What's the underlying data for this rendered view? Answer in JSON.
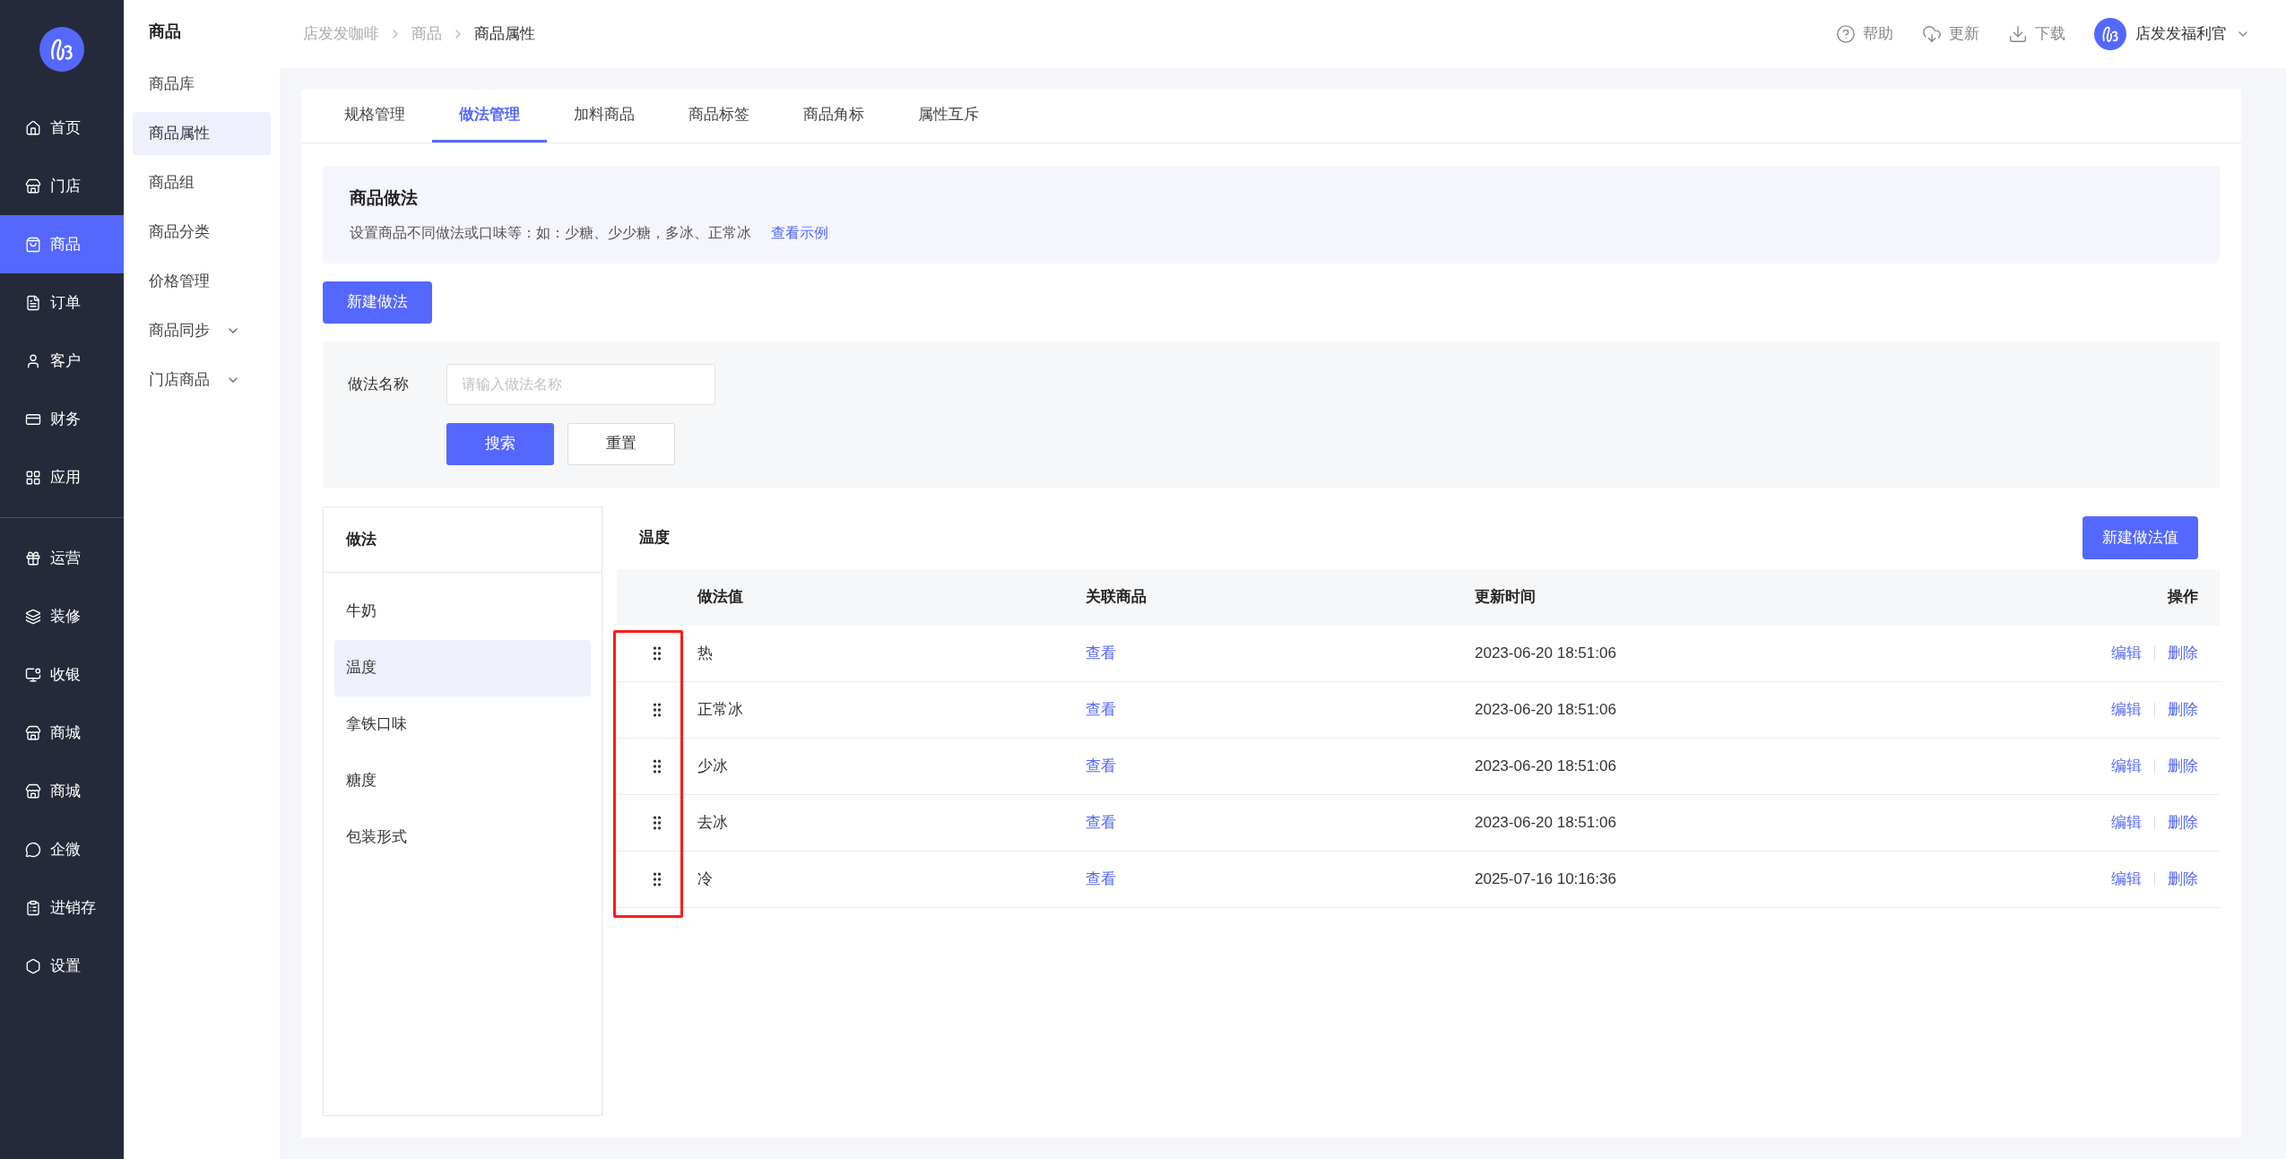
{
  "sidebar": {
    "groups": [
      [
        {
          "label": "首页",
          "selected": false
        },
        {
          "label": "门店",
          "selected": false
        },
        {
          "label": "商品",
          "selected": true
        },
        {
          "label": "订单",
          "selected": false
        },
        {
          "label": "客户",
          "selected": false
        },
        {
          "label": "财务",
          "selected": false
        },
        {
          "label": "应用",
          "selected": false
        }
      ],
      [
        {
          "label": "运营",
          "selected": false
        },
        {
          "label": "装修",
          "selected": false
        },
        {
          "label": "收银",
          "selected": false
        },
        {
          "label": "商城",
          "selected": false
        },
        {
          "label": "商城",
          "selected": false
        },
        {
          "label": "企微",
          "selected": false
        },
        {
          "label": "进销存",
          "selected": false
        },
        {
          "label": "设置",
          "selected": false
        }
      ]
    ]
  },
  "submenu": {
    "title": "商品",
    "items": [
      {
        "label": "商品库",
        "selected": false,
        "expandable": false
      },
      {
        "label": "商品属性",
        "selected": true,
        "expandable": false
      },
      {
        "label": "商品组",
        "selected": false,
        "expandable": false
      },
      {
        "label": "商品分类",
        "selected": false,
        "expandable": false
      },
      {
        "label": "价格管理",
        "selected": false,
        "expandable": false
      },
      {
        "label": "商品同步",
        "selected": false,
        "expandable": true
      },
      {
        "label": "门店商品",
        "selected": false,
        "expandable": true
      }
    ]
  },
  "header": {
    "breadcrumb": [
      "店发发咖啡",
      "商品",
      "商品属性"
    ],
    "actions": [
      "帮助",
      "更新",
      "下载"
    ],
    "user": "店发发福利官"
  },
  "tabs": [
    {
      "label": "规格管理",
      "selected": false
    },
    {
      "label": "做法管理",
      "selected": true
    },
    {
      "label": "加料商品",
      "selected": false
    },
    {
      "label": "商品标签",
      "selected": false
    },
    {
      "label": "商品角标",
      "selected": false
    },
    {
      "label": "属性互斥",
      "selected": false
    }
  ],
  "info": {
    "title": "商品做法",
    "text": "设置商品不同做法或口味等：如：少糖、少少糖，多冰、正常冰",
    "link": "查看示例"
  },
  "new_button": "新建做法",
  "search": {
    "label": "做法名称",
    "placeholder": "请输入做法名称",
    "buttons": [
      {
        "label": "搜索",
        "kind": "primary"
      },
      {
        "label": "重置",
        "kind": "default"
      }
    ]
  },
  "methods": {
    "title": "做法",
    "items": [
      {
        "label": "牛奶",
        "selected": false
      },
      {
        "label": "温度",
        "selected": true
      },
      {
        "label": "拿铁口味",
        "selected": false
      },
      {
        "label": "糖度",
        "selected": false
      },
      {
        "label": "包装形式",
        "selected": false
      }
    ]
  },
  "values": {
    "title": "温度",
    "new_button": "新建做法值",
    "columns": [
      "做法值",
      "关联商品",
      "更新时间",
      "操作"
    ],
    "rows": [
      {
        "value": "热",
        "link": "查看",
        "time": "2023-06-20 18:51:06",
        "actions": [
          "编辑",
          "删除"
        ]
      },
      {
        "value": "正常冰",
        "link": "查看",
        "time": "2023-06-20 18:51:06",
        "actions": [
          "编辑",
          "删除"
        ]
      },
      {
        "value": "少冰",
        "link": "查看",
        "time": "2023-06-20 18:51:06",
        "actions": [
          "编辑",
          "删除"
        ]
      },
      {
        "value": "去冰",
        "link": "查看",
        "time": "2023-06-20 18:51:06",
        "actions": [
          "编辑",
          "删除"
        ]
      },
      {
        "value": "冷",
        "link": "查看",
        "time": "2025-07-16 10:16:36",
        "actions": [
          "编辑",
          "删除"
        ]
      }
    ]
  }
}
